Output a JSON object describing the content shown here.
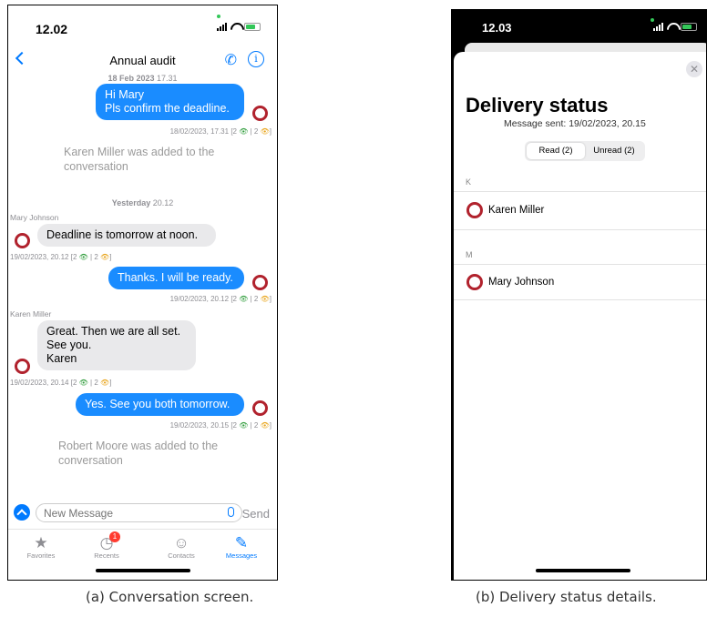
{
  "screen_a": {
    "status_time": "12.02",
    "title": "Annual audit",
    "messages": [
      {
        "kind": "date",
        "text": "18 Feb 2023",
        "time": "17.31"
      },
      {
        "kind": "out",
        "lines": [
          "Hi Mary",
          "Pls confirm the deadline."
        ],
        "meta": "18/02/2023, 17.31",
        "read": "2",
        "unread": "2"
      },
      {
        "kind": "system",
        "text": "Karen Miller was added to the conversation"
      },
      {
        "kind": "date",
        "text": "Yesterday",
        "time": "20.12"
      },
      {
        "kind": "in",
        "sender": "Mary Johnson",
        "lines": [
          "Deadline is tomorrow at noon."
        ],
        "meta": "19/02/2023, 20.12",
        "read": "2",
        "unread": "2"
      },
      {
        "kind": "out",
        "lines": [
          "Thanks. I will be ready."
        ],
        "meta": "19/02/2023, 20.12",
        "read": "2",
        "unread": "2"
      },
      {
        "kind": "in",
        "sender": "Karen Miller",
        "lines": [
          "Great. Then we are all set.",
          "See you.",
          "Karen"
        ],
        "meta": "19/02/2023, 20.14",
        "read": "2",
        "unread": "2"
      },
      {
        "kind": "out",
        "lines": [
          "Yes. See you both tomorrow."
        ],
        "meta": "19/02/2023, 20.15",
        "read": "2",
        "unread": "2"
      },
      {
        "kind": "system",
        "text": "Robert Moore was added to the conversation"
      }
    ],
    "input_placeholder": "New Message",
    "send_label": "Send",
    "tabs": [
      {
        "label": "Favorites",
        "icon": "star-icon"
      },
      {
        "label": "Recents",
        "icon": "clock-icon",
        "badge": "1"
      },
      {
        "label": "Contacts",
        "icon": "person-icon"
      },
      {
        "label": "Messages",
        "icon": "compose-icon",
        "active": true
      }
    ],
    "caption": "(a) Conversation screen."
  },
  "screen_b": {
    "status_time": "12.03",
    "title": "Delivery status",
    "subtitle": "Message sent: 19/02/2023, 20.15",
    "segments": [
      "Read (2)",
      "Unread (2)"
    ],
    "sections": [
      {
        "header": "K",
        "name": "Karen Miller"
      },
      {
        "header": "M",
        "name": "Mary Johnson"
      }
    ],
    "close_glyph": "✕",
    "caption": "(b) Delivery status details."
  },
  "colors": {
    "accent": "#007aff",
    "bubble_out": "#1a8cff",
    "bubble_in": "#e9e9eb",
    "avatar_ring": "#b1222d",
    "read_eye": "#2e9c3a",
    "unread_eye": "#e8a317"
  }
}
